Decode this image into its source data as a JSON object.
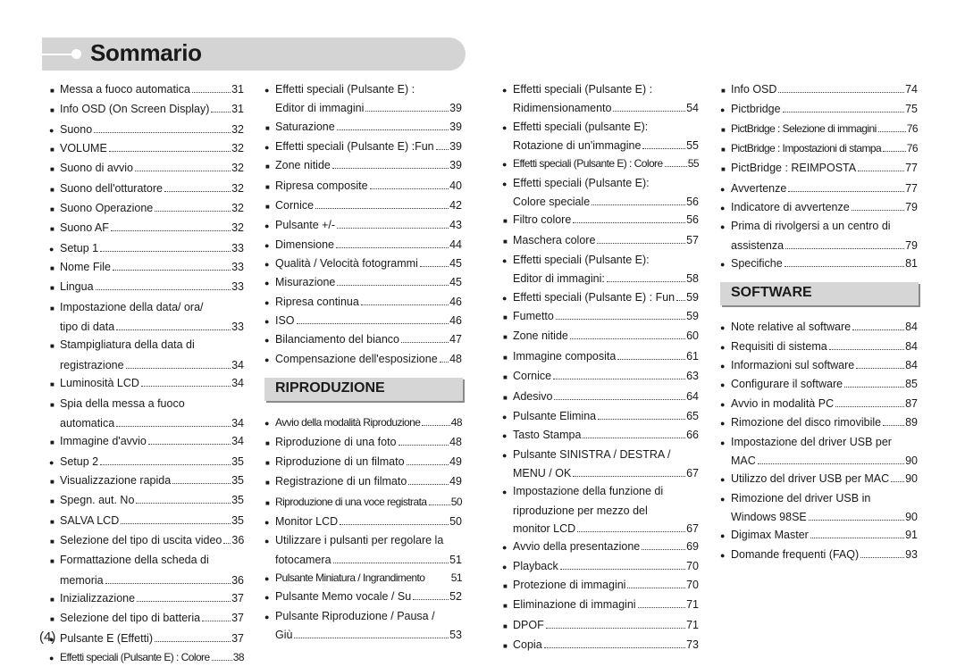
{
  "page": {
    "title": "Sommario",
    "page_number": "(4)"
  },
  "icons": {
    "round_bullet": "●",
    "square_bullet": "■"
  },
  "columns": [
    {
      "entries": [
        {
          "bullet": "square",
          "lines": [
            "Messa a fuoco automatica"
          ],
          "page": "31"
        },
        {
          "bullet": "square",
          "lines": [
            "Info OSD (On Screen Display)"
          ],
          "page": "31"
        },
        {
          "bullet": "round",
          "lines": [
            "Suono"
          ],
          "page": "32"
        },
        {
          "bullet": "square",
          "lines": [
            "VOLUME"
          ],
          "page": "32"
        },
        {
          "bullet": "square",
          "lines": [
            "Suono di avvio"
          ],
          "page": "32"
        },
        {
          "bullet": "square",
          "lines": [
            "Suono dell'otturatore"
          ],
          "page": "32"
        },
        {
          "bullet": "square",
          "lines": [
            "Suono Operazione"
          ],
          "page": "32"
        },
        {
          "bullet": "square",
          "lines": [
            "Suono AF"
          ],
          "page": "32"
        },
        {
          "bullet": "round",
          "lines": [
            "Setup 1"
          ],
          "page": "33"
        },
        {
          "bullet": "square",
          "lines": [
            "Nome File"
          ],
          "page": "33"
        },
        {
          "bullet": "square",
          "lines": [
            "Lingua"
          ],
          "page": "33"
        },
        {
          "bullet": "square",
          "lines": [
            "Impostazione della data/ ora/",
            "tipo di data"
          ],
          "page": "33"
        },
        {
          "bullet": "square",
          "lines": [
            "Stampigliatura della data di",
            "registrazione"
          ],
          "page": "34"
        },
        {
          "bullet": "square",
          "lines": [
            "Luminosità LCD"
          ],
          "page": "34"
        },
        {
          "bullet": "square",
          "lines": [
            "Spia della messa a fuoco",
            "automatica"
          ],
          "page": "34"
        },
        {
          "bullet": "square",
          "lines": [
            "Immagine d'avvio"
          ],
          "page": "34"
        },
        {
          "bullet": "round",
          "lines": [
            "Setup 2"
          ],
          "page": "35"
        },
        {
          "bullet": "square",
          "lines": [
            "Visualizzazione rapida"
          ],
          "page": "35"
        },
        {
          "bullet": "square",
          "lines": [
            "Spegn. aut. No"
          ],
          "page": "35"
        },
        {
          "bullet": "square",
          "lines": [
            "SALVA LCD"
          ],
          "page": "35"
        },
        {
          "bullet": "square",
          "lines": [
            "Selezione del tipo di uscita video"
          ],
          "page": "36"
        },
        {
          "bullet": "square",
          "lines": [
            "Formattazione della scheda di",
            "memoria"
          ],
          "page": "36"
        },
        {
          "bullet": "square",
          "lines": [
            "Inizializzazione"
          ],
          "page": "37"
        },
        {
          "bullet": "square",
          "lines": [
            "Selezione del tipo di batteria"
          ],
          "page": "37"
        },
        {
          "bullet": "round",
          "lines": [
            "Pulsante E (Effetti)"
          ],
          "page": "37"
        },
        {
          "bullet": "round",
          "lines": [
            "Effetti speciali (Pulsante E) : Colore"
          ],
          "page": "38",
          "condensed": true
        }
      ]
    },
    {
      "entries": [
        {
          "bullet": "round",
          "lines": [
            "Effetti speciali (Pulsante E) :",
            "Editor di immagini"
          ],
          "page": "39"
        },
        {
          "bullet": "square",
          "lines": [
            "Saturazione"
          ],
          "page": "39"
        },
        {
          "bullet": "round",
          "lines": [
            "Effetti speciali (Pulsante E) :Fun"
          ],
          "page": "39"
        },
        {
          "bullet": "square",
          "lines": [
            "Zone nitide"
          ],
          "page": "39"
        },
        {
          "bullet": "square",
          "lines": [
            "Ripresa composite"
          ],
          "page": "40"
        },
        {
          "bullet": "square",
          "lines": [
            "Cornice"
          ],
          "page": "42"
        },
        {
          "bullet": "round",
          "lines": [
            "Pulsante +/-"
          ],
          "page": "43"
        },
        {
          "bullet": "round",
          "lines": [
            "Dimensione"
          ],
          "page": "44"
        },
        {
          "bullet": "round",
          "lines": [
            "Qualità / Velocità fotogrammi"
          ],
          "page": "45"
        },
        {
          "bullet": "round",
          "lines": [
            "Misurazione"
          ],
          "page": "45"
        },
        {
          "bullet": "round",
          "lines": [
            "Ripresa continua"
          ],
          "page": "46"
        },
        {
          "bullet": "round",
          "lines": [
            "ISO"
          ],
          "page": "46"
        },
        {
          "bullet": "round",
          "lines": [
            "Bilanciamento del bianco"
          ],
          "page": "47"
        },
        {
          "bullet": "round",
          "lines": [
            "Compensazione dell'esposizione"
          ],
          "page": "48"
        },
        {
          "section": "RIPRODUZIONE"
        },
        {
          "bullet": "round",
          "lines": [
            "Avvio della modalità Riproduzione"
          ],
          "page": "48",
          "condensed": true
        },
        {
          "bullet": "square",
          "lines": [
            "Riproduzione di una foto"
          ],
          "page": "48"
        },
        {
          "bullet": "square",
          "lines": [
            "Riproduzione di un filmato"
          ],
          "page": "49"
        },
        {
          "bullet": "square",
          "lines": [
            "Registrazione di un filmato"
          ],
          "page": "49"
        },
        {
          "bullet": "square",
          "lines": [
            "Riproduzione di una voce registrata"
          ],
          "page": "50",
          "condensed": true
        },
        {
          "bullet": "round",
          "lines": [
            "Monitor LCD"
          ],
          "page": "50"
        },
        {
          "bullet": "round",
          "lines": [
            "Utilizzare i pulsanti per regolare la",
            "fotocamera"
          ],
          "page": "51"
        },
        {
          "bullet": "round",
          "lines": [
            "Pulsante Miniatura / Ingrandimento"
          ],
          "page": "51",
          "condensed": true,
          "no_leader": true
        },
        {
          "bullet": "round",
          "lines": [
            "Pulsante Memo vocale / Su"
          ],
          "page": "52"
        },
        {
          "bullet": "round",
          "lines": [
            "Pulsante Riproduzione / Pausa /",
            "Giù"
          ],
          "page": "53"
        }
      ]
    },
    {
      "entries": [
        {
          "bullet": "round",
          "lines": [
            "Effetti speciali (Pulsante E) :",
            "Ridimensionamento"
          ],
          "page": "54"
        },
        {
          "bullet": "round",
          "lines": [
            "Effetti speciali (pulsante E):",
            "Rotazione di un'immagine"
          ],
          "page": "55"
        },
        {
          "bullet": "round",
          "lines": [
            "Effetti speciali (Pulsante E) : Colore"
          ],
          "page": "55",
          "condensed": true
        },
        {
          "bullet": "round",
          "lines": [
            "Effetti speciali (Pulsante E):",
            "Colore speciale"
          ],
          "page": "56"
        },
        {
          "bullet": "square",
          "lines": [
            "Filtro colore"
          ],
          "page": "56"
        },
        {
          "bullet": "square",
          "lines": [
            "Maschera colore"
          ],
          "page": "57"
        },
        {
          "bullet": "round",
          "lines": [
            "Effetti speciali (Pulsante E):",
            "Editor di immagini:"
          ],
          "page": "58"
        },
        {
          "bullet": "round",
          "lines": [
            "Effetti speciali (Pulsante E) : Fun"
          ],
          "page": "59"
        },
        {
          "bullet": "square",
          "lines": [
            "Fumetto"
          ],
          "page": "59"
        },
        {
          "bullet": "square",
          "lines": [
            "Zone nitide"
          ],
          "page": "60"
        },
        {
          "bullet": "square",
          "lines": [
            "Immagine composita"
          ],
          "page": "61"
        },
        {
          "bullet": "square",
          "lines": [
            "Cornice"
          ],
          "page": "63"
        },
        {
          "bullet": "square",
          "lines": [
            "Adesivo"
          ],
          "page": "64"
        },
        {
          "bullet": "round",
          "lines": [
            "Pulsante Elimina"
          ],
          "page": "65"
        },
        {
          "bullet": "round",
          "lines": [
            "Tasto Stampa"
          ],
          "page": "66"
        },
        {
          "bullet": "round",
          "lines": [
            "Pulsante SINISTRA / DESTRA /",
            "MENU / OK"
          ],
          "page": "67"
        },
        {
          "bullet": "round",
          "lines": [
            "Impostazione della funzione di",
            "riproduzione per mezzo del",
            "monitor LCD"
          ],
          "page": "67"
        },
        {
          "bullet": "round",
          "lines": [
            "Avvio della presentazione"
          ],
          "page": "69"
        },
        {
          "bullet": "round",
          "lines": [
            "Playback"
          ],
          "page": "70"
        },
        {
          "bullet": "square",
          "lines": [
            "Protezione di immagini"
          ],
          "page": "70"
        },
        {
          "bullet": "square",
          "lines": [
            "Eliminazione di immagini"
          ],
          "page": "71"
        },
        {
          "bullet": "square",
          "lines": [
            "DPOF"
          ],
          "page": "71"
        },
        {
          "bullet": "square",
          "lines": [
            "Copia"
          ],
          "page": "73"
        }
      ]
    },
    {
      "entries": [
        {
          "bullet": "square",
          "lines": [
            "Info OSD"
          ],
          "page": "74"
        },
        {
          "bullet": "round",
          "lines": [
            "Pictbridge"
          ],
          "page": "75"
        },
        {
          "bullet": "square",
          "lines": [
            "PictBridge : Selezione di immagini"
          ],
          "page": "76",
          "condensed": true
        },
        {
          "bullet": "square",
          "lines": [
            "PictBridge : Impostazioni di stampa"
          ],
          "page": "76",
          "condensed": true
        },
        {
          "bullet": "square",
          "lines": [
            "PictBridge : REIMPOSTA"
          ],
          "page": "77"
        },
        {
          "bullet": "round",
          "lines": [
            "Avvertenze"
          ],
          "page": "77"
        },
        {
          "bullet": "round",
          "lines": [
            "Indicatore di avvertenze"
          ],
          "page": "79"
        },
        {
          "bullet": "round",
          "lines": [
            "Prima di rivolgersi a un centro di",
            "assistenza"
          ],
          "page": "79"
        },
        {
          "bullet": "round",
          "lines": [
            "Specifiche"
          ],
          "page": "81"
        },
        {
          "section": "SOFTWARE"
        },
        {
          "bullet": "round",
          "lines": [
            "Note relative al software"
          ],
          "page": "84"
        },
        {
          "bullet": "round",
          "lines": [
            "Requisiti di sistema"
          ],
          "page": "84"
        },
        {
          "bullet": "round",
          "lines": [
            "Informazioni sul software"
          ],
          "page": "84"
        },
        {
          "bullet": "round",
          "lines": [
            "Configurare il software"
          ],
          "page": "85"
        },
        {
          "bullet": "round",
          "lines": [
            "Avvio in modalità PC"
          ],
          "page": "87"
        },
        {
          "bullet": "round",
          "lines": [
            "Rimozione del disco rimovibile"
          ],
          "page": "89"
        },
        {
          "bullet": "round",
          "lines": [
            "Impostazione del driver USB per",
            "MAC"
          ],
          "page": "90"
        },
        {
          "bullet": "round",
          "lines": [
            "Utilizzo del driver USB per MAC"
          ],
          "page": "90"
        },
        {
          "bullet": "round",
          "lines": [
            "Rimozione del driver USB in",
            "Windows 98SE"
          ],
          "page": "90"
        },
        {
          "bullet": "round",
          "lines": [
            "Digimax Master"
          ],
          "page": "91"
        },
        {
          "bullet": "round",
          "lines": [
            "Domande frequenti (FAQ)"
          ],
          "page": "93"
        }
      ]
    }
  ]
}
